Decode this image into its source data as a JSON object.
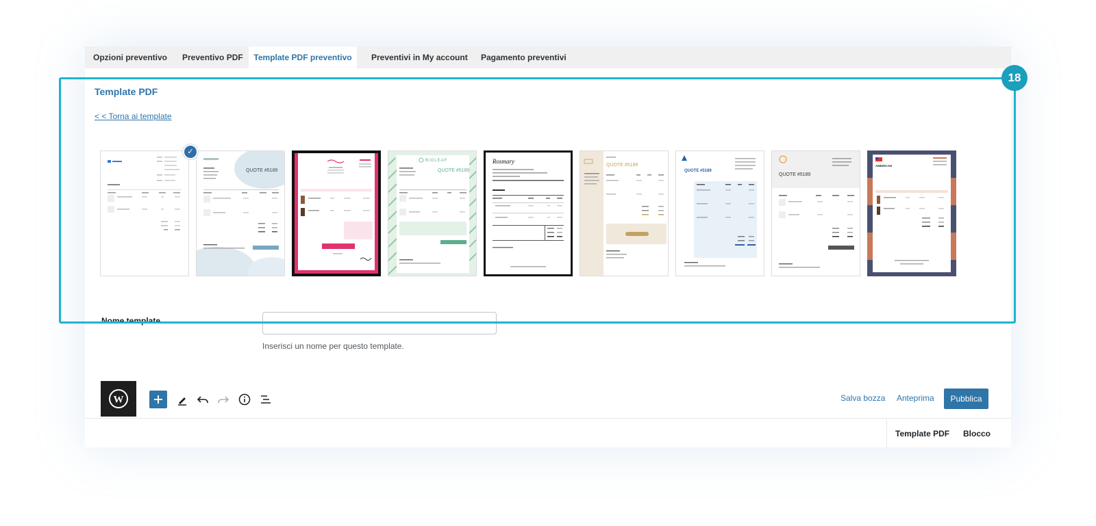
{
  "tabs": [
    {
      "label": "Opzioni preventivo"
    },
    {
      "label": "Preventivo PDF"
    },
    {
      "label": "Template PDF preventivo"
    },
    {
      "label": "Preventivi in My account"
    },
    {
      "label": "Pagamento preventivi"
    }
  ],
  "active_tab": "Template PDF preventivo",
  "section": {
    "title": "Template PDF",
    "back_link": "< < Torna ai template"
  },
  "templates": [
    {
      "heading": "",
      "brand": "",
      "accent": "#3a7bd5",
      "selected": true
    },
    {
      "heading": "QUOTE #5189",
      "brand": "",
      "accent": "#7aa6c2",
      "selected": false
    },
    {
      "heading": "",
      "brand": "",
      "accent": "#e0336b",
      "selected": false
    },
    {
      "heading": "QUOTE #5189",
      "brand": "BIOLEAF",
      "accent": "#5fae8c",
      "selected": false
    },
    {
      "heading": "",
      "brand": "Rosmary",
      "accent": "#111111",
      "selected": false
    },
    {
      "heading": "QUOTE #5189",
      "brand": "",
      "accent": "#c2a25f",
      "selected": false
    },
    {
      "heading": "QUOTE #5189",
      "brand": "",
      "accent": "#2b5fa3",
      "selected": false
    },
    {
      "heading": "QUOTE #5189",
      "brand": "",
      "accent": "#555555",
      "selected": false
    },
    {
      "heading": "",
      "brand": "AMERICAN",
      "accent": "#c7795a",
      "selected": false
    }
  ],
  "template_name": {
    "label": "Nome template",
    "value": "",
    "placeholder": "",
    "help": "Inserisci un nome per questo template."
  },
  "callout": {
    "number": "18",
    "color": "#1fb3cf"
  },
  "toolbar": {
    "save_draft": "Salva bozza",
    "preview": "Anteprima",
    "publish": "Pubblica",
    "icons": [
      "wordpress-icon",
      "plus-icon",
      "pencil-icon",
      "undo-icon",
      "redo-icon",
      "info-icon",
      "list-view-icon"
    ]
  },
  "sidebar_tabs": [
    "Template PDF",
    "Blocco"
  ],
  "colors": {
    "accent": "#2f75a8",
    "highlight": "#1fb3cf",
    "callout": "#1a9fbd"
  }
}
